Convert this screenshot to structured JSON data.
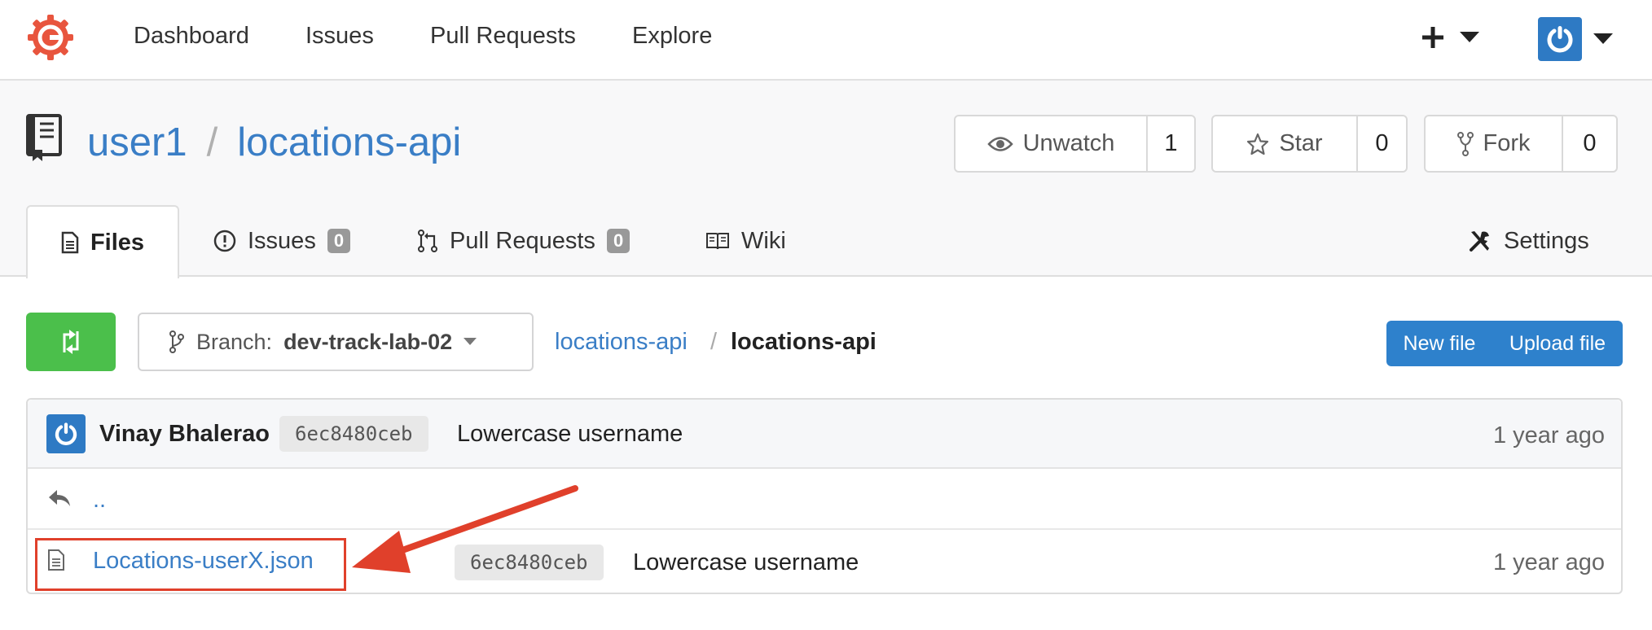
{
  "topnav": {
    "links": [
      "Dashboard",
      "Issues",
      "Pull Requests",
      "Explore"
    ],
    "plus_icon": "plus-icon",
    "avatar_icon": "power-icon"
  },
  "repo": {
    "owner": "user1",
    "separator": "/",
    "name": "locations-api",
    "watch": {
      "label": "Unwatch",
      "count": "1"
    },
    "star": {
      "label": "Star",
      "count": "0"
    },
    "fork": {
      "label": "Fork",
      "count": "0"
    }
  },
  "tabs": {
    "files": "Files",
    "issues": {
      "label": "Issues",
      "count": "0"
    },
    "pulls": {
      "label": "Pull Requests",
      "count": "0"
    },
    "wiki": "Wiki",
    "settings": "Settings"
  },
  "toolbar": {
    "branch_prefix": "Branch:",
    "branch_name": "dev-track-lab-02",
    "breadcrumb_root": "locations-api",
    "breadcrumb_sep": "/",
    "breadcrumb_current": "locations-api",
    "new_file": "New file",
    "upload_file": "Upload file"
  },
  "latest_commit": {
    "author": "Vinay Bhalerao",
    "sha": "6ec8480ceb",
    "message": "Lowercase username",
    "time": "1 year ago"
  },
  "parent_link": "..",
  "files": [
    {
      "name": "Locations-userX.json",
      "sha": "6ec8480ceb",
      "message": "Lowercase username",
      "time": "1 year ago"
    }
  ],
  "colors": {
    "link": "#3a7ec6",
    "compare": "#4bbf4b",
    "primary": "#2e81cc",
    "annotation": "#e0402b",
    "logo": "#e8553e"
  }
}
